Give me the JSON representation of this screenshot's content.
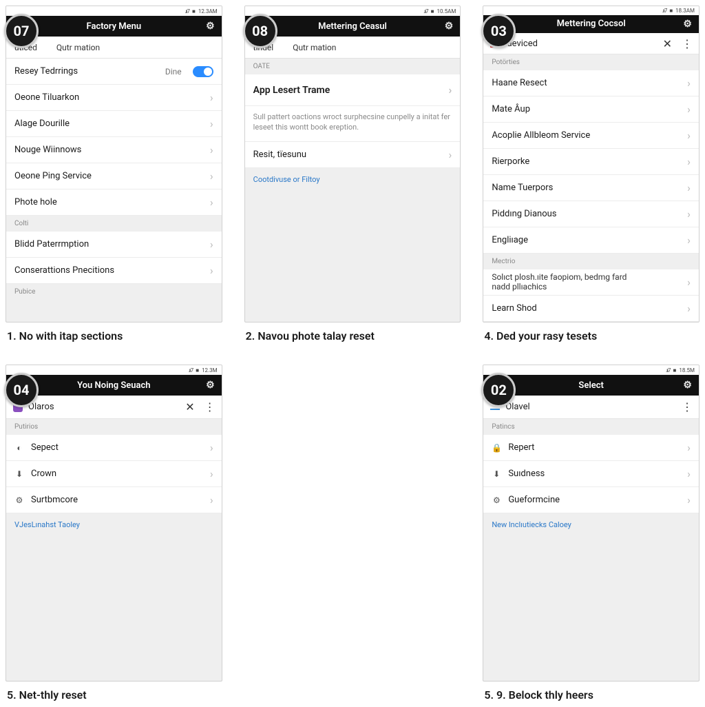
{
  "panels": {
    "p07": {
      "badge": "07",
      "status_time": "12.3AM",
      "title": "Factory Menu",
      "tabs": [
        "uticed",
        "Qutr mation"
      ],
      "rows": [
        {
          "label": "Resey Tedrrings",
          "value": "Dine",
          "toggle": true
        },
        {
          "label": "Oeone Tiluarkon",
          "chev": true
        },
        {
          "label": "Alage Dourille",
          "chev": true
        },
        {
          "label": "Nouge Wiinnows",
          "chev": true
        },
        {
          "label": "Oeone Ping Service",
          "chev": true
        },
        {
          "label": "Phote hole",
          "chev": true
        }
      ],
      "section2": "Colti",
      "rows2": [
        {
          "label": "Blidd Paterrmption",
          "chev": true
        },
        {
          "label": "Conserattions Pnecitions",
          "chev": true
        }
      ],
      "section3": "Pubice",
      "caption": "1. No with itap sections"
    },
    "p08": {
      "badge": "08",
      "status_time": "10.5AM",
      "title": "Mettering Ceasul",
      "tabs": [
        "tindel",
        "Qutr mation"
      ],
      "section1": "OATE",
      "bigrow": "App Lesert Trame",
      "desc": "Sull pattert oactions wroct surphecsine cunpelly a initat fer leseet this wontt book ereption.",
      "row2": "Resit, tïesunu",
      "link": "Cootdivuse or Filtoy",
      "caption": "2. Navou phote talay reset"
    },
    "p03": {
      "badge": "03",
      "status_time": "18.3AM",
      "title": "Mettering Cocsol",
      "sub_label": "deviced",
      "section1": "Potörties",
      "rows": [
        {
          "label": "Haane Resect"
        },
        {
          "label": "Mate Âup"
        },
        {
          "label": "Acoplie Allbleom Service"
        },
        {
          "label": "Rierporke"
        },
        {
          "label": "Name Tuerpors"
        },
        {
          "label": "Piddıng Dianous"
        },
        {
          "label": "Engliıage"
        }
      ],
      "section2": "Mectrio",
      "rows2": [
        {
          "l1": "Solıct plosh.ıite faopiom, bedmg fard",
          "l2": "nadd pllıachics"
        },
        {
          "label": "Learn Shod"
        }
      ],
      "caption": "4. Ded your rasy tesets"
    },
    "p04": {
      "badge": "04",
      "status_time": "12.3M",
      "title": "You Noing Seuach",
      "sub_label": "Olaros",
      "section1": "Putirios",
      "rows": [
        {
          "icon": "person",
          "label": "Sepect"
        },
        {
          "icon": "download",
          "label": "Crown"
        },
        {
          "icon": "gear",
          "label": "Surtbmcore"
        }
      ],
      "link": "VJesLınahst Taoley",
      "caption": "5. Net-thly reset"
    },
    "p02": {
      "badge": "02",
      "status_time": "18.5M",
      "title": "Select",
      "sub_label": "Olavel",
      "section1": "Patincs",
      "rows": [
        {
          "icon": "lock",
          "label": "Repert"
        },
        {
          "icon": "download",
          "label": "Suıdness"
        },
        {
          "icon": "gear",
          "label": "Gueformcine"
        }
      ],
      "link": "New lnclıutiecks Caloey",
      "caption": "5. 9. Belock thly heers"
    }
  }
}
